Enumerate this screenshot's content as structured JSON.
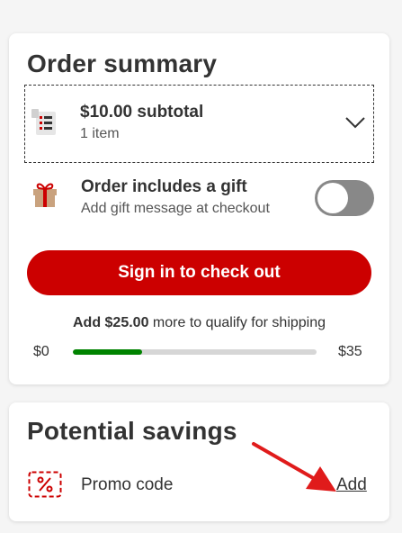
{
  "order_summary": {
    "heading": "Order summary",
    "subtotal": "$10.00 subtotal",
    "item_count": "1 item",
    "gift": {
      "title": "Order includes a gift",
      "subtitle": "Add gift message at checkout",
      "toggle_on": false
    },
    "checkout_button": "Sign in to check out",
    "shipping": {
      "amount": "Add $25.00",
      "message": " more to qualify for shipping",
      "range_min": "$0",
      "range_max": "$35",
      "progress_fraction": 0.2857
    }
  },
  "potential_savings": {
    "heading": "Potential savings",
    "promo_label": "Promo code",
    "add_link": "Add"
  },
  "colors": {
    "brand_red": "#cc0000",
    "progress_green": "#008300",
    "annotation_arrow": "#e01b1b"
  },
  "icons": [
    "receipt-icon",
    "chevron-down-icon",
    "gift-icon",
    "percent-tag-icon",
    "arrow-annotation"
  ]
}
